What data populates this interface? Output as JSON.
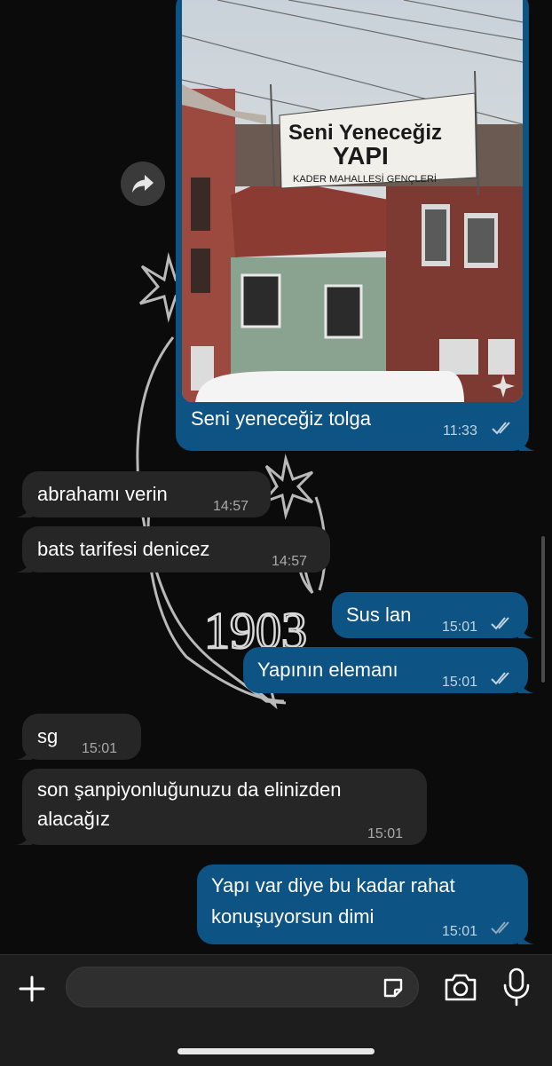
{
  "chat": {
    "photo_message": {
      "banner": [
        "Seni Yeneceğiz",
        "YAPI",
        "KADER MAHALLESİ GENÇLERİ"
      ],
      "caption": "Seni yeneceğiz tolga",
      "time": "11:33",
      "status": "read"
    },
    "wallpaper_text": "1903",
    "messages": [
      {
        "dir": "in",
        "text": "abrahamı verin",
        "time": "14:57"
      },
      {
        "dir": "in",
        "text": "bats tarifesi denicez",
        "time": "14:57"
      },
      {
        "dir": "out",
        "text": "Sus lan",
        "time": "15:01",
        "status": "read"
      },
      {
        "dir": "out",
        "text": "Yapının elemanı",
        "time": "15:01",
        "status": "read"
      },
      {
        "dir": "in",
        "text": "sg",
        "time": "15:01"
      },
      {
        "dir": "in",
        "lines": [
          "son şanpiyonluğunuzu da elinizden",
          "alacağız"
        ],
        "time": "15:01"
      },
      {
        "dir": "out",
        "lines": [
          "Yapı var diye bu kadar rahat",
          "konuşuyorsun dimi"
        ],
        "time": "15:01",
        "status": "delivered"
      }
    ]
  },
  "input_bar": {
    "placeholder": "",
    "icons": [
      "plus-icon",
      "sticker-icon",
      "camera-icon",
      "microphone-icon"
    ]
  },
  "colors": {
    "background": "#0b0b0b",
    "incoming_bubble": "#262626",
    "outgoing_bubble": "#0d5384",
    "read_tick": "#c2d4e2"
  }
}
